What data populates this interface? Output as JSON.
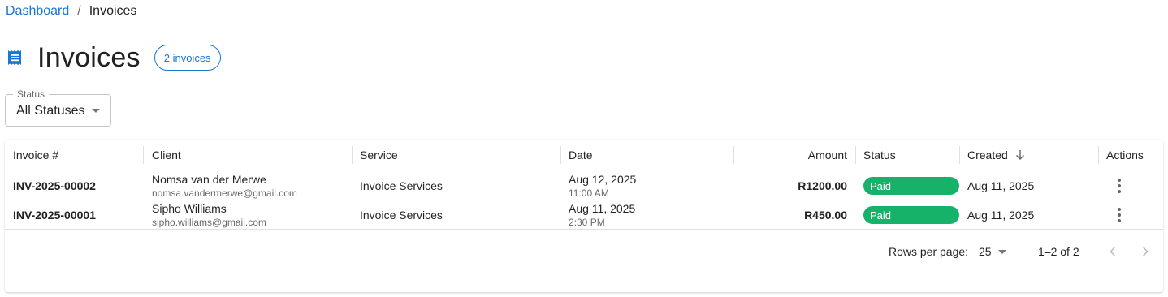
{
  "breadcrumb": {
    "items": [
      {
        "label": "Dashboard"
      }
    ],
    "separator": "/",
    "current": "Invoices"
  },
  "header": {
    "title": "Invoices",
    "icon": "receipt-icon",
    "count_chip": "2 invoices"
  },
  "filter": {
    "label": "Status",
    "value": "All Statuses"
  },
  "table": {
    "columns": [
      "Invoice #",
      "Client",
      "Service",
      "Date",
      "Amount",
      "Status",
      "Created",
      "Actions"
    ],
    "sort": {
      "column": "Created",
      "direction": "desc"
    },
    "rows": [
      {
        "invoice": "INV-2025-00002",
        "client_name": "Nomsa van der Merwe",
        "client_email": "nomsa.vandermerwe@gmail.com",
        "service": "Invoice Services",
        "date": "Aug 12, 2025",
        "time": "11:00 AM",
        "amount": "R1200.00",
        "status": "Paid",
        "created": "Aug 11, 2025"
      },
      {
        "invoice": "INV-2025-00001",
        "client_name": "Sipho Williams",
        "client_email": "sipho.williams@gmail.com",
        "service": "Invoice Services",
        "date": "Aug 11, 2025",
        "time": "2:30 PM",
        "amount": "R450.00",
        "status": "Paid",
        "created": "Aug 11, 2025"
      }
    ]
  },
  "pagination": {
    "rows_per_page_label": "Rows per page:",
    "rows_per_page": "25",
    "range": "1–2 of 2"
  },
  "colors": {
    "primary": "#1976d2",
    "paid_badge": "#17b26a"
  }
}
